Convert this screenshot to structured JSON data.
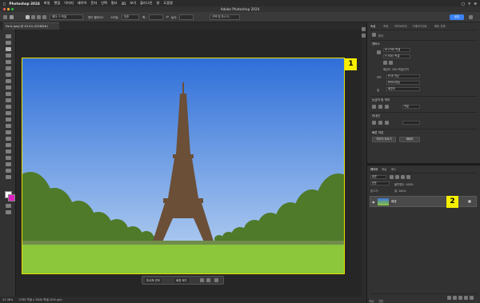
{
  "menubar": {
    "apple": "",
    "app": "Photoshop 2024",
    "items": [
      "파일",
      "편집",
      "이미지",
      "레이어",
      "문자",
      "선택",
      "필터",
      "3D",
      "보기",
      "플러그인",
      "창",
      "도움말"
    ]
  },
  "window": {
    "title": "Adobe Photoshop 2024"
  },
  "options": {
    "feather": "페더: 0 픽셀",
    "antialias": "앤티 앨리어스",
    "style_label": "스타일:",
    "style_value": "표준",
    "width_label": "폭:",
    "height_label": "높이:",
    "select_mask": "선택 및 마스크...",
    "share": "공유"
  },
  "document": {
    "tab": "Paris.jpeg @ 43.4% (RGB/8#)",
    "status": "43.38%",
    "status_size": "5760 픽셀 x 3840 픽셀 (300 ppi)"
  },
  "callouts": {
    "one": "1",
    "two": "2"
  },
  "context_bar": {
    "select_subject": "피사체 선택",
    "remove_bg": "배경 제거"
  },
  "properties": {
    "tabs": [
      "속성",
      "조정",
      "라이브러리",
      "그레이디언트",
      "패턴 전체"
    ],
    "kind": "문서",
    "canvas_section": "캔버스",
    "width": "W  5760 픽셀",
    "height": "H  3840 픽셀",
    "resolution": "해상도: 300 픽셀/인치",
    "mode_label": "모드",
    "mode_value": "RGB 색상",
    "bits": "8비트/채널",
    "fill_label": "칠",
    "fill_value": "배경색",
    "rulers_section": "눈금자 및 격자",
    "rulers_unit": "픽셀",
    "guides_section": "안내선",
    "quick_section": "빠른 작업",
    "trim": "이미지 자르기",
    "rotate": "재배치"
  },
  "layers": {
    "tabs": [
      "레이어",
      "채널",
      "패스"
    ],
    "kind_label": "종류",
    "blend": "표준",
    "opacity": "불투명도: 100%",
    "lock": "잠그기:",
    "fill": "칠: 100%",
    "layer_name": "배경",
    "bottom_tabs": [
      "색상",
      "견본"
    ]
  },
  "colors": {
    "sky_top": "#2f6fd9",
    "sky_bottom": "#bcd5f2",
    "grass": "#8cc63a",
    "trees": "#4e7a2a",
    "tower": "#6b4f37",
    "accent": "#f7ef00"
  }
}
